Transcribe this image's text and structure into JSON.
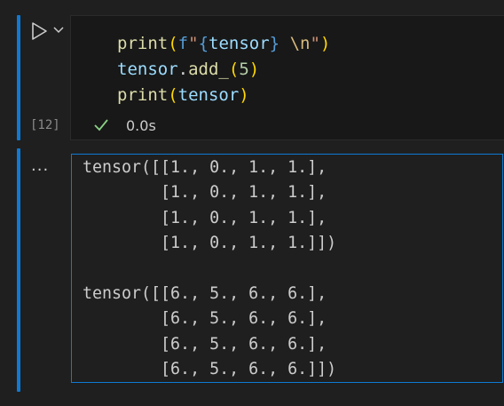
{
  "code_cell": {
    "execution_count": "[12]",
    "status": "success",
    "duration": "0.0s",
    "lines": [
      {
        "fn": "print",
        "o": "(",
        "f": "f",
        "q1": "\"",
        "b1": "{",
        "var": "tensor",
        "b2": "}",
        "sp": " ",
        "esc": "\\n",
        "q2": "\"",
        "c": ")"
      },
      {
        "var": "tensor",
        "dot": ".",
        "method": "add_",
        "o": "(",
        "num": "5",
        "c": ")"
      },
      {
        "fn": "print",
        "o": "(",
        "var": "tensor",
        "c": ")"
      }
    ]
  },
  "output": {
    "more_label": "...",
    "lines": [
      "tensor([[1., 0., 1., 1.],",
      "        [1., 0., 1., 1.],",
      "        [1., 0., 1., 1.],",
      "        [1., 0., 1., 1.]])",
      "",
      "tensor([[6., 5., 6., 6.],",
      "        [6., 5., 6., 6.],",
      "        [6., 5., 6., 6.],",
      "        [6., 5., 6., 6.]])"
    ]
  },
  "icons": {
    "run": "play-icon",
    "run_menu": "chevron-down-icon",
    "status": "check-icon"
  },
  "colors": {
    "accent": "#0e7ad3",
    "success": "#89d185",
    "background": "#1f1f1f"
  }
}
